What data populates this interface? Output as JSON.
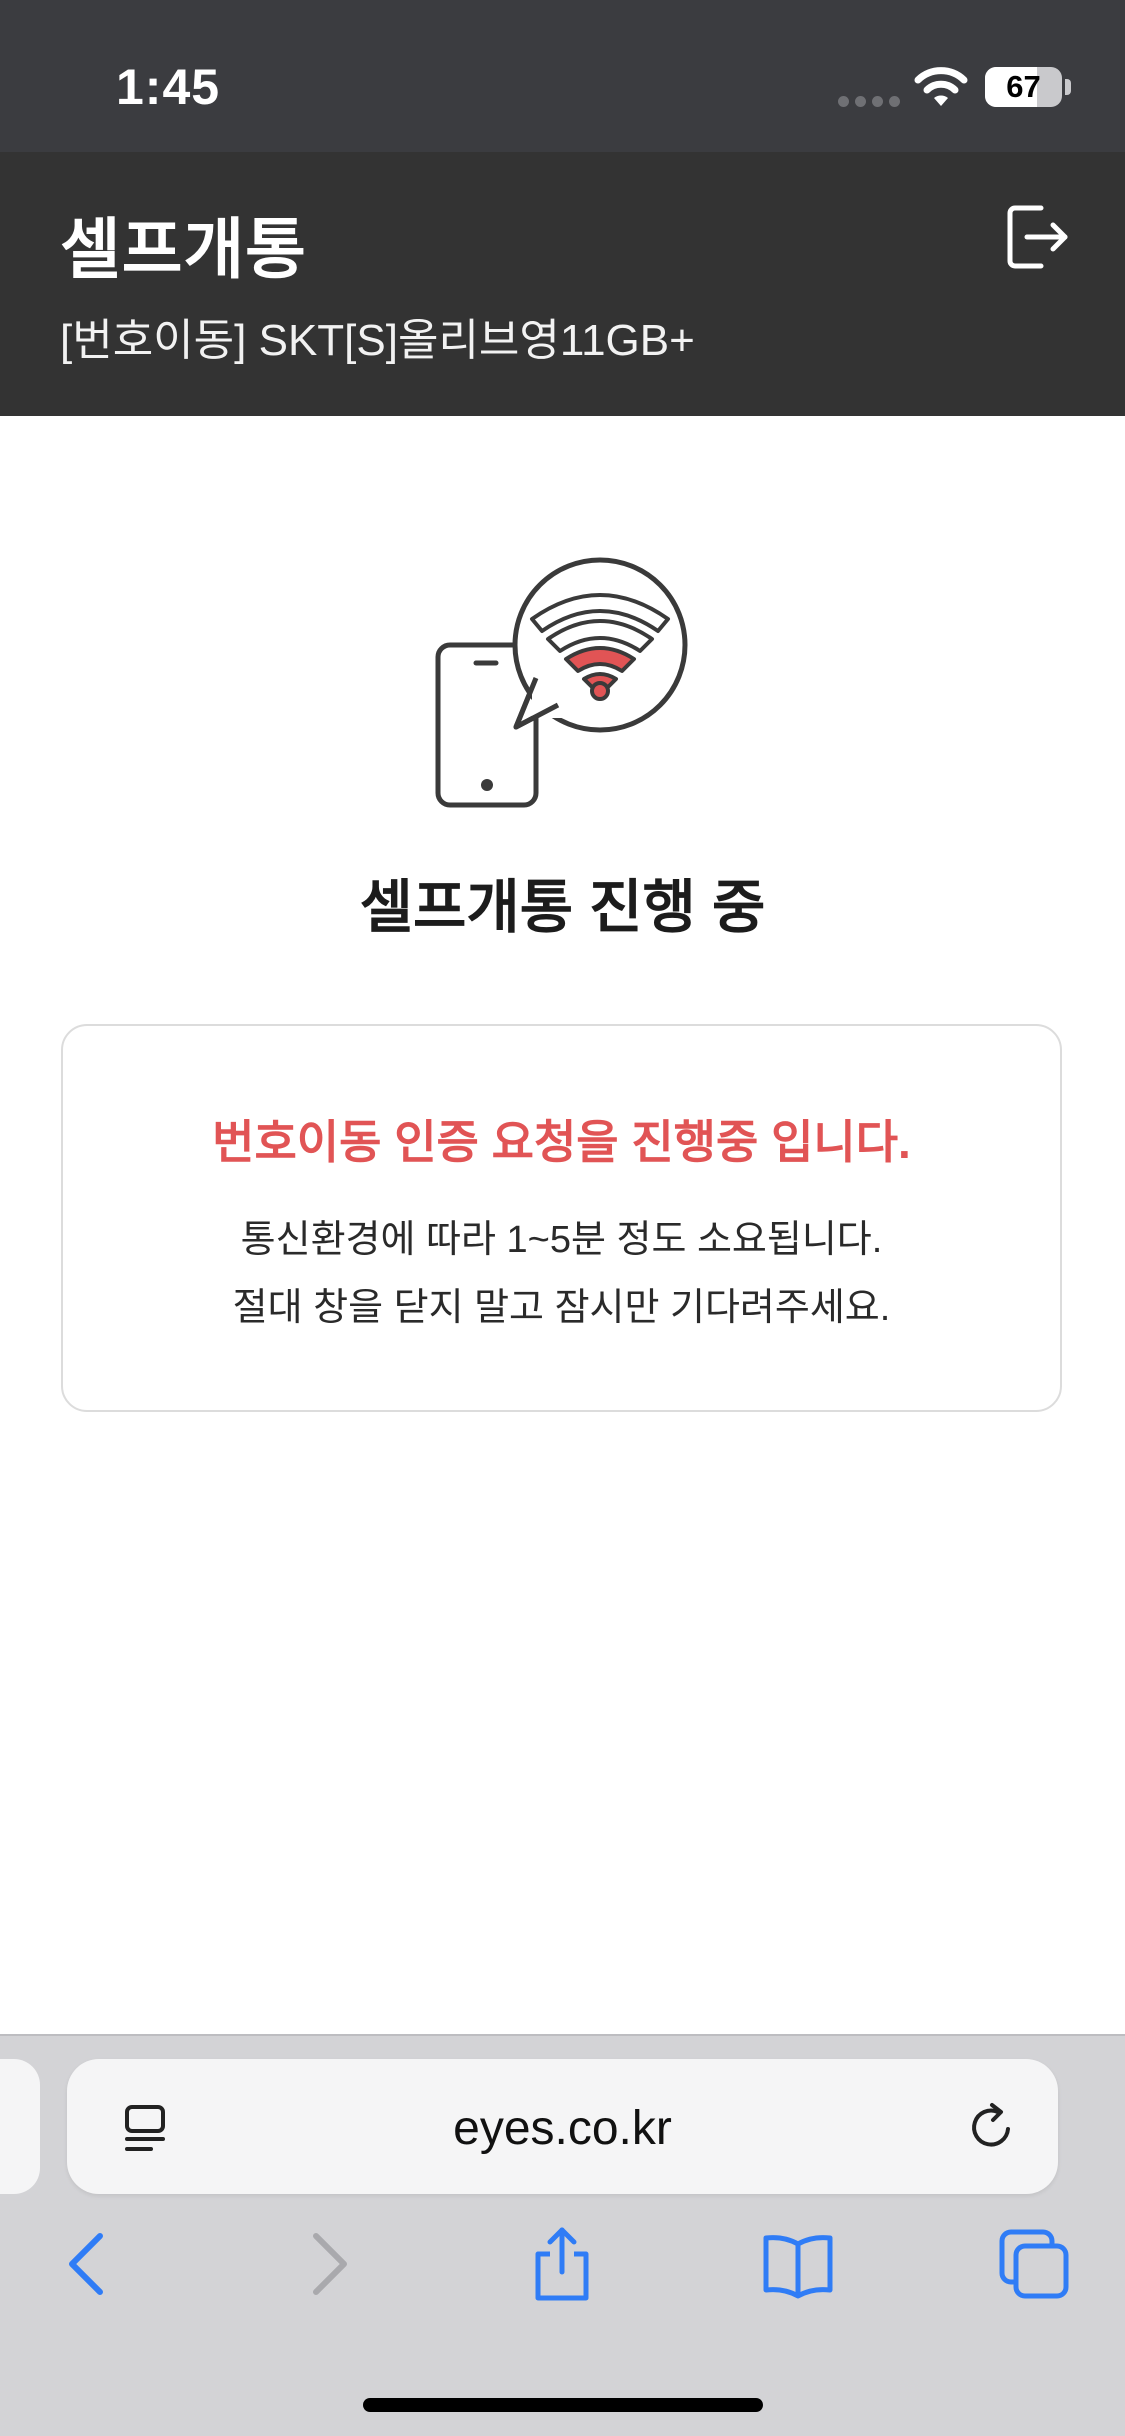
{
  "status_bar": {
    "time": "1:45",
    "battery_level": "67",
    "battery_fraction": 0.67,
    "icons": [
      "signal-dots-icon",
      "wifi-icon",
      "battery-icon"
    ]
  },
  "header": {
    "title": "셀프개통",
    "subtitle": "[번호이동] SKT[S]올리브영11GB+",
    "logout_icon": "logout-icon"
  },
  "main": {
    "illustration_icon": "phone-wifi-icon",
    "heading": "셀프개통 진행 중",
    "notice": {
      "title": "번호이동 인증 요청을 진행중 입니다.",
      "line1": "통신환경에 따라 1~5분 정도 소요됩니다.",
      "line2": "절대 창을 닫지 말고 잠시만 기다려주세요."
    }
  },
  "browser": {
    "url": "eyes.co.kr",
    "toolbar": [
      "back-icon",
      "forward-icon",
      "share-icon",
      "bookmarks-icon",
      "tabs-icon"
    ]
  },
  "colors": {
    "accent": "#e15455",
    "header_bg": "#333333",
    "ios_blue": "#2f7cf6"
  }
}
